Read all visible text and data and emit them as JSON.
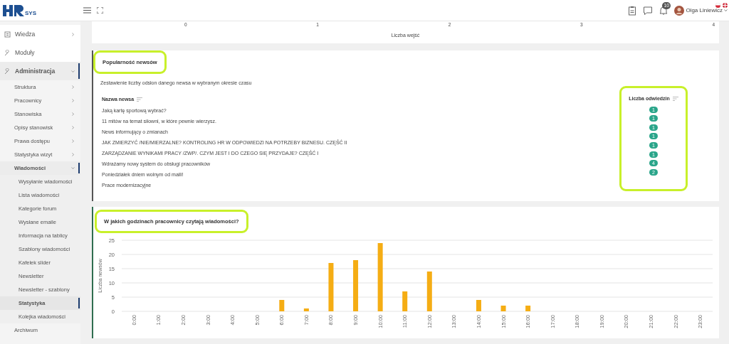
{
  "header": {
    "logo_text": "SYS",
    "notifications": "10",
    "user": "Olga Liniewicz"
  },
  "sidebar": {
    "items": [
      {
        "label": "Wiedza",
        "kind": "section",
        "expanded": false,
        "selected": false
      },
      {
        "label": "Moduły",
        "kind": "section",
        "selected": false
      },
      {
        "label": "Administracja",
        "kind": "section",
        "expanded": true,
        "selected": true,
        "children": [
          {
            "label": "Struktura",
            "expanded": false,
            "selected": false
          },
          {
            "label": "Pracownicy",
            "expanded": false,
            "selected": false
          },
          {
            "label": "Stanowiska",
            "expanded": false,
            "selected": false
          },
          {
            "label": "Opisy stanowisk",
            "expanded": false,
            "selected": false
          },
          {
            "label": "Prawa dostępu",
            "expanded": false,
            "selected": false
          },
          {
            "label": "Statystyka wizyt",
            "expanded": false,
            "selected": false
          },
          {
            "label": "Wiadomości",
            "expanded": true,
            "selected": true,
            "children": [
              {
                "label": "Wysyłanie wiadomości",
                "selected": false
              },
              {
                "label": "Lista wiadomości",
                "selected": false
              },
              {
                "label": "Kategorie forum",
                "selected": false
              },
              {
                "label": "Wysłane emaile",
                "selected": false
              },
              {
                "label": "Informacja na tablicy",
                "selected": false
              },
              {
                "label": "Szablony wiadomości",
                "selected": false
              },
              {
                "label": "Kafelek slider",
                "selected": false
              },
              {
                "label": "Newsletter",
                "selected": false
              },
              {
                "label": "Newsletter - szablony",
                "selected": false
              },
              {
                "label": "Statystyka",
                "selected": true
              },
              {
                "label": "Kolejka wiadomości",
                "selected": false
              }
            ]
          }
        ]
      },
      {
        "label": "Archiwum",
        "kind": "link",
        "selected": false
      }
    ]
  },
  "visits_chart": {
    "xticks": [
      "0",
      "1",
      "2",
      "3",
      "4"
    ],
    "xlabel": "Liczba wejść"
  },
  "news_popularity": {
    "title": "Popularność newsów",
    "description": "Zestawienie liczby odsłon danego newsa w wybranym okresie czasu",
    "columns": [
      "Nazwa newsa",
      "Liczba odwiedzin"
    ],
    "rows": [
      {
        "name": "Jaką kartę sportową wybrać?",
        "visits": "1"
      },
      {
        "name": "11 mitów na temat siłowni, w które pewnie wierzysz.",
        "visits": "1"
      },
      {
        "name": "News informujący o zmianach",
        "visits": "1"
      },
      {
        "name": "JAK ZMIERZYĆ /NIE/MIERZALNE? KONTROLING HR W ODPOWIEDZI NA POTRZEBY BIZNESU. CZĘŚĆ II",
        "visits": "1"
      },
      {
        "name": "ZARZĄDZANIE WYNIKAMI PRACY /ZWP/. CZYM JEST I DO CZEGO SIĘ PRZYDAJE? CZĘŚĆ I",
        "visits": "1"
      },
      {
        "name": "Wdrażamy nowy system do obsługi pracowników",
        "visits": "1"
      },
      {
        "name": "Poniedziałek dniem wolnym od maili!",
        "visits": "4"
      },
      {
        "name": "Prace modernizacyjne",
        "visits": "2"
      }
    ]
  },
  "reading_hours": {
    "title": "W jakich godzinach pracownicy czytają wiadomości?",
    "chart_data": {
      "type": "bar",
      "ylabel": "Liczba newsów",
      "categories": [
        "0:00",
        "1:00",
        "2:00",
        "3:00",
        "4:00",
        "5:00",
        "6:00",
        "7:00",
        "8:00",
        "9:00",
        "10:00",
        "11:00",
        "12:00",
        "13:00",
        "14:00",
        "15:00",
        "16:00",
        "17:00",
        "18:00",
        "19:00",
        "20:00",
        "21:00",
        "22:00",
        "23:00"
      ],
      "values": [
        0,
        0,
        0,
        0,
        0,
        0,
        4,
        1,
        17,
        18,
        24,
        7,
        14,
        0,
        4,
        2,
        2,
        0,
        0,
        0,
        0,
        0,
        0,
        0
      ],
      "ylim": [
        0,
        25
      ],
      "yticks": [
        0,
        5,
        10,
        15,
        20,
        25
      ],
      "grid": true
    }
  }
}
